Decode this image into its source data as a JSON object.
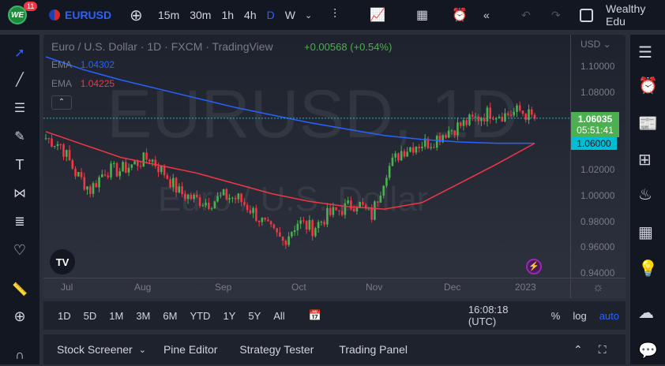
{
  "topbar": {
    "notifications": "11",
    "logo_text": "WE",
    "symbol": "EURUSD",
    "timeframes": [
      "15m",
      "30m",
      "1h",
      "4h",
      "D",
      "W"
    ],
    "active_timeframe": "D",
    "account": "Wealthy Edu"
  },
  "legend": {
    "title": "Euro / U.S. Dollar · 1D · FXCM · TradingView",
    "change": "+0.00568 (+0.54%)",
    "ema1_label": "EMA",
    "ema1_value": "1.04302",
    "ema2_label": "EMA",
    "ema2_value": "1.04225"
  },
  "watermark": {
    "symbol": "EURUSD, 1D",
    "name": "Euro / U.S. Dollar"
  },
  "price_axis": {
    "currency": "USD",
    "ticks": [
      "1.10000",
      "1.08000",
      "1.06000",
      "1.04000",
      "1.02000",
      "1.00000",
      "0.98000",
      "0.96000",
      "0.94000"
    ],
    "last_price": "1.06035",
    "countdown": "05:51:41",
    "crosshair_price": "1.06000"
  },
  "time_axis": {
    "labels": [
      "Jul",
      "Aug",
      "Sep",
      "Oct",
      "Nov",
      "Dec",
      "2023"
    ]
  },
  "bottom": {
    "ranges": [
      "1D",
      "5D",
      "1M",
      "3M",
      "6M",
      "YTD",
      "1Y",
      "5Y",
      "All"
    ],
    "time": "16:08:18 (UTC)",
    "percent": "%",
    "log": "log",
    "auto": "auto"
  },
  "panel": {
    "tabs": [
      "Stock Screener",
      "Pine Editor",
      "Strategy Tester",
      "Trading Panel"
    ]
  },
  "colors": {
    "up": "#26a69a",
    "up_candle": "#4caf50",
    "down": "#f23645",
    "ema_blue": "#2962ff",
    "ema_red": "#f23645",
    "last": "#4caf50",
    "cross": "#00bcd4"
  },
  "chart_data": {
    "type": "candlestick",
    "ylim": [
      0.94,
      1.1
    ],
    "weekly_closes": [
      1.045,
      1.04,
      1.018,
      1.005,
      1.02,
      1.02,
      1.025,
      1.03,
      1.018,
      1.003,
      0.998,
      0.995,
      1.0,
      0.998,
      0.988,
      0.975,
      0.965,
      0.98,
      0.975,
      0.985,
      0.99,
      0.995,
      0.985,
      1.02,
      1.035,
      1.04,
      1.042,
      1.05,
      1.055,
      1.06,
      1.065,
      1.063,
      1.066,
      1.06
    ],
    "ema_blue": [
      1.108,
      1.098,
      1.09,
      1.083,
      1.076,
      1.069,
      1.063,
      1.057,
      1.052,
      1.047,
      1.044,
      1.042,
      1.041,
      1.041
    ],
    "ema_red": [
      1.05,
      1.04,
      1.03,
      1.024,
      1.018,
      1.01,
      1.002,
      0.996,
      0.992,
      0.99,
      0.995,
      1.01,
      1.025,
      1.041
    ]
  }
}
